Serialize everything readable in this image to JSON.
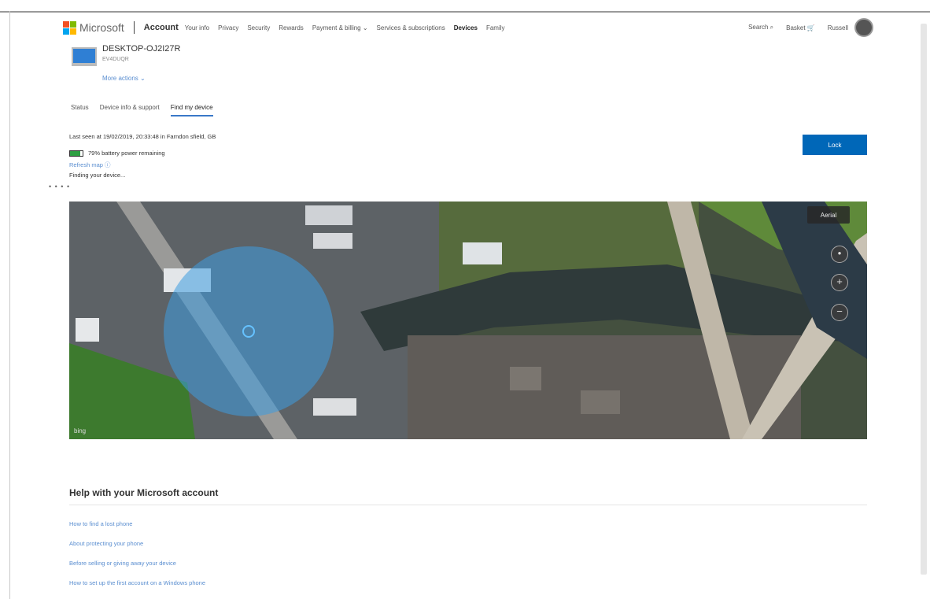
{
  "header": {
    "brand": "Microsoft",
    "account_label": "Account",
    "nav": [
      {
        "label": "Your info",
        "active": false
      },
      {
        "label": "Privacy",
        "active": false
      },
      {
        "label": "Security",
        "active": false
      },
      {
        "label": "Rewards",
        "active": false
      },
      {
        "label": "Payment & billing ⌄",
        "active": false
      },
      {
        "label": "Services & subscriptions",
        "active": false
      },
      {
        "label": "Devices",
        "active": true
      },
      {
        "label": "Family",
        "active": false
      }
    ],
    "search_label": "Search ⌕",
    "basket_label": "Basket 🛒",
    "user_name": "Russell"
  },
  "device": {
    "name": "DESKTOP-OJ2I27R",
    "model": "EV4DUQR",
    "more_actions": "More actions ⌄"
  },
  "tabs": [
    {
      "label": "Status",
      "active": false
    },
    {
      "label": "Device info & support",
      "active": false
    },
    {
      "label": "Find my device",
      "active": true
    }
  ],
  "status": {
    "last_seen": "Last seen at 19/02/2019, 20:33:48 in Farndon sfield, GB",
    "battery_text": "79% battery power remaining",
    "battery_level": 0.79,
    "refresh_map": "Refresh map ⓘ",
    "finding": "Finding your device..."
  },
  "lock_button": "Lock",
  "map": {
    "aerial_label": "Aerial",
    "bing_label": "bing"
  },
  "help": {
    "title": "Help with your Microsoft account",
    "links": [
      "How to find a lost phone",
      "About protecting your phone",
      "Before selling or giving away your device",
      "How to set up the first account on a Windows phone"
    ]
  },
  "colors": {
    "accent": "#0067b8",
    "link": "#5a8ed0",
    "battery": "#2ea043"
  }
}
